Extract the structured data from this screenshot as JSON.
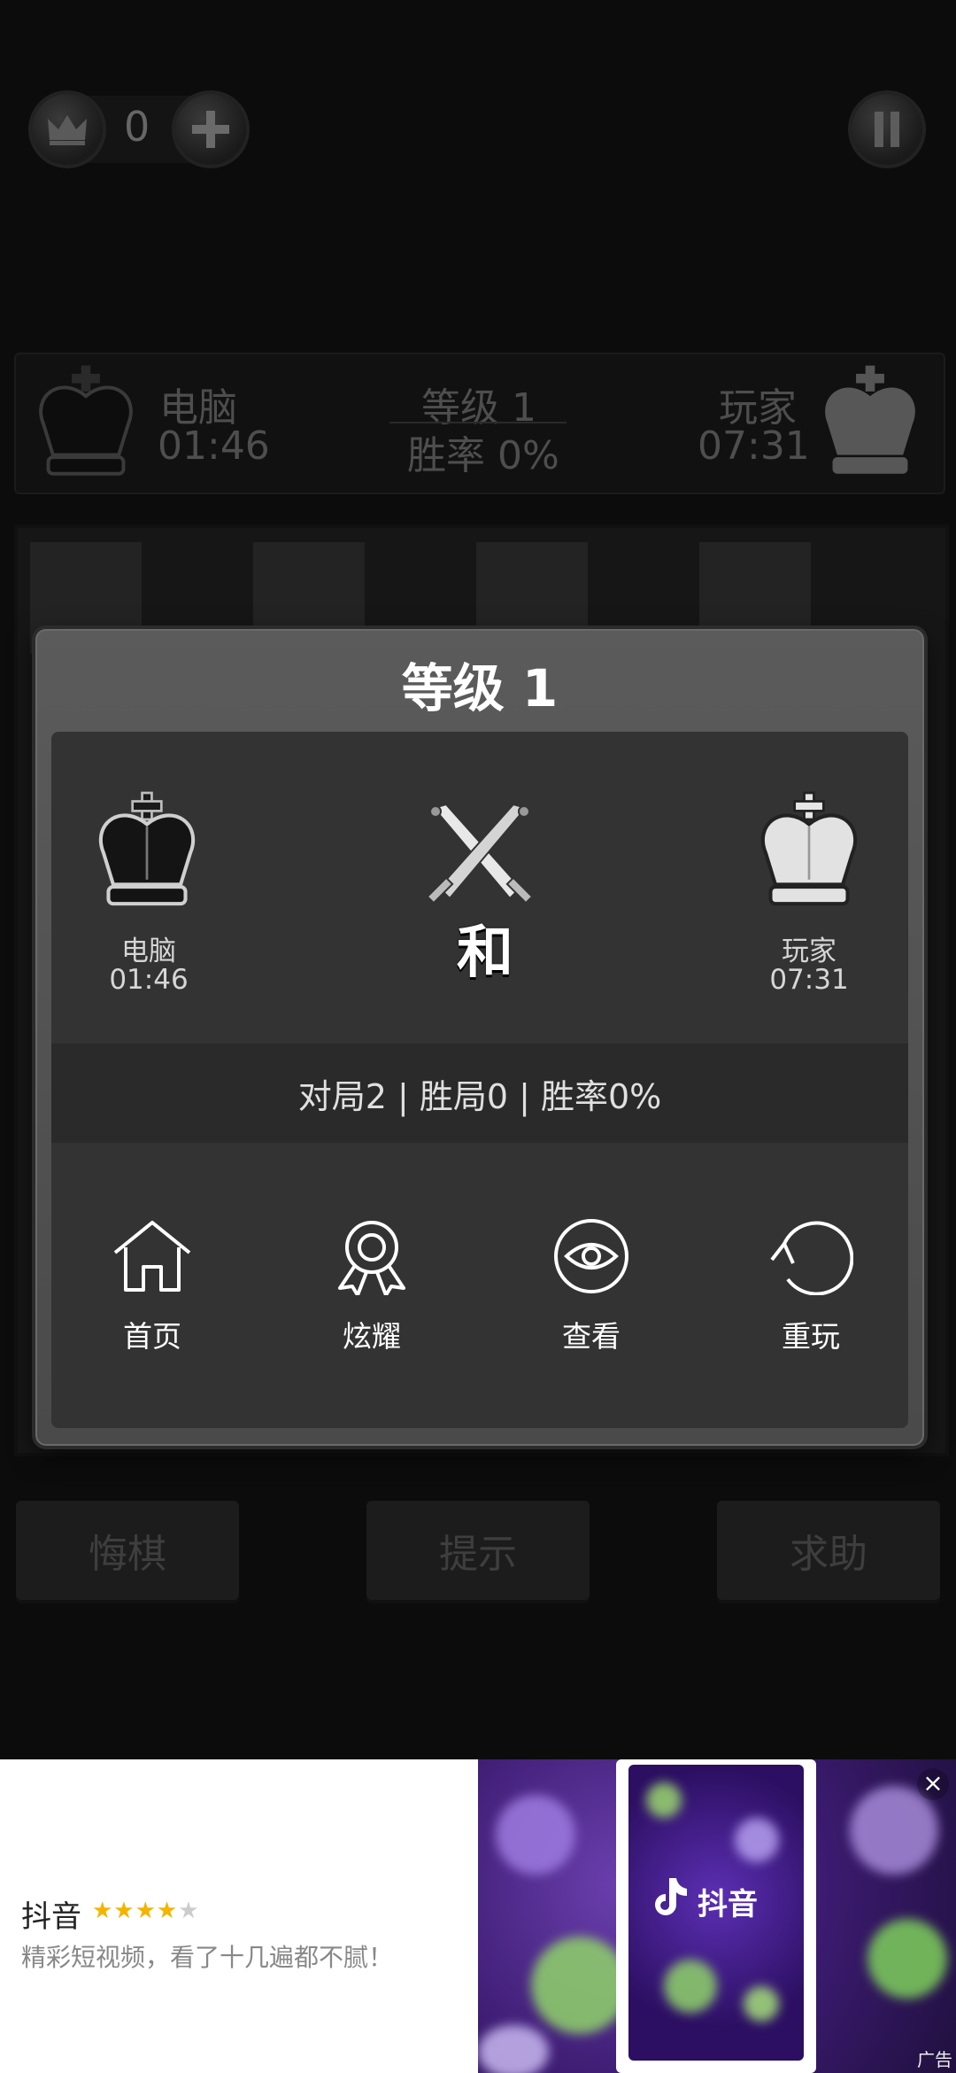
{
  "top_bar": {
    "coins": "0"
  },
  "info_bar": {
    "computer_name": "电脑",
    "computer_time": "01:46",
    "level": "等级 1",
    "win_rate": "胜率 0%",
    "player_name": "玩家",
    "player_time": "07:31"
  },
  "modal": {
    "title": "等级 1",
    "computer": {
      "name": "电脑",
      "time": "01:46"
    },
    "player": {
      "name": "玩家",
      "time": "07:31"
    },
    "result": "和",
    "stats": "对局2 | 胜局0 | 胜率0%",
    "actions": [
      {
        "label": "首页",
        "icon": "home-icon"
      },
      {
        "label": "炫耀",
        "icon": "medal-icon"
      },
      {
        "label": "查看",
        "icon": "eye-icon"
      },
      {
        "label": "重玩",
        "icon": "replay-icon"
      }
    ]
  },
  "game_buttons": {
    "undo": "悔棋",
    "hint": "提示",
    "help": "求助"
  },
  "ad": {
    "app_name": "抖音",
    "rating": 4,
    "description": "精彩短视频，看了十几遍都不腻！",
    "brand": "抖音",
    "tag": "广告"
  },
  "colors": {
    "background": "#0c0c0c",
    "modal": "#4f4f4f",
    "modal_inner": "#333333",
    "star": "#f4b400"
  }
}
